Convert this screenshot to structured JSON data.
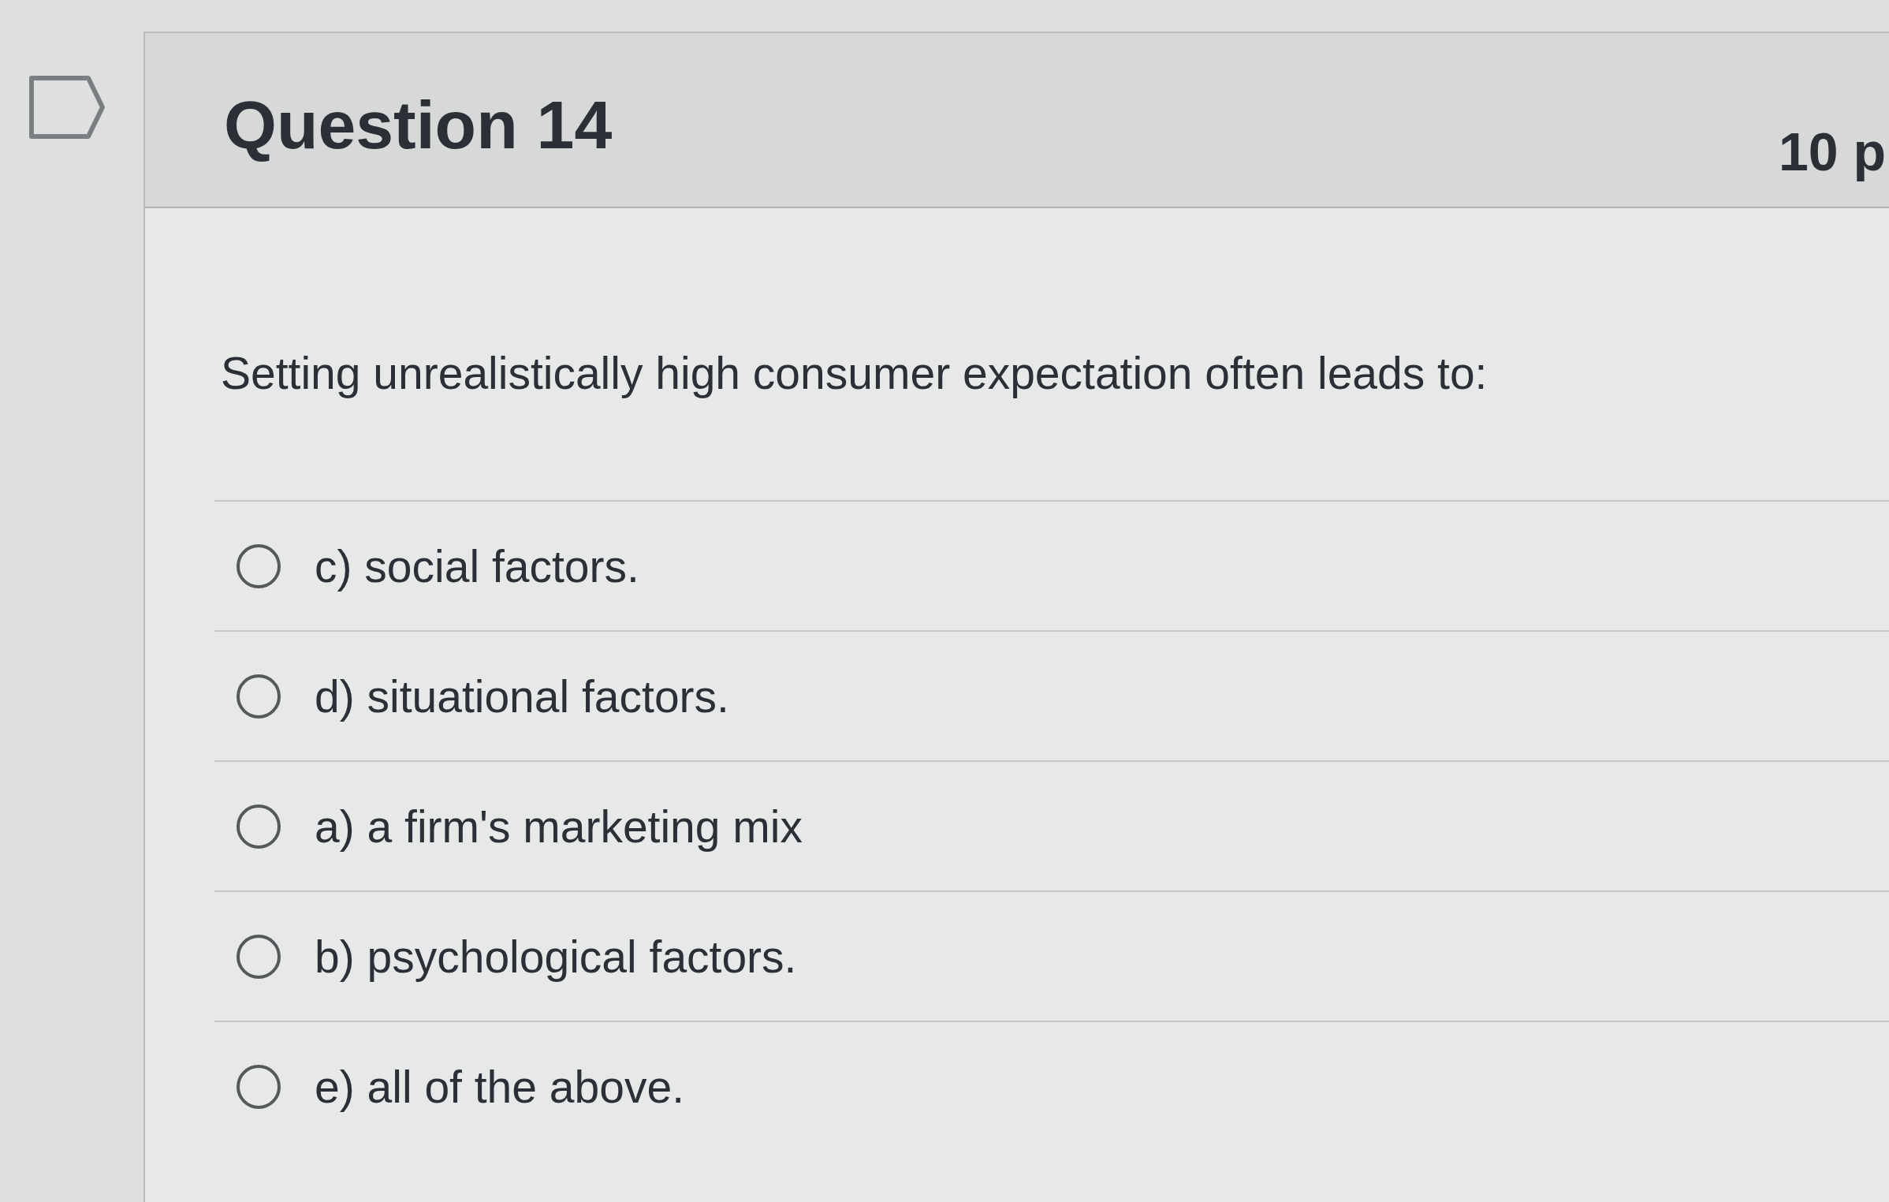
{
  "question": {
    "title": "Question 14",
    "points": "10 p",
    "text": "Setting unrealistically high consumer expectation often leads to:",
    "answers": [
      {
        "label": "c) social factors.",
        "selected": false
      },
      {
        "label": "d) situational factors.",
        "selected": false
      },
      {
        "label": "a) a firm's marketing mix",
        "selected": false
      },
      {
        "label": "b) psychological factors.",
        "selected": false
      },
      {
        "label": "e) all of the above.",
        "selected": false
      }
    ]
  }
}
